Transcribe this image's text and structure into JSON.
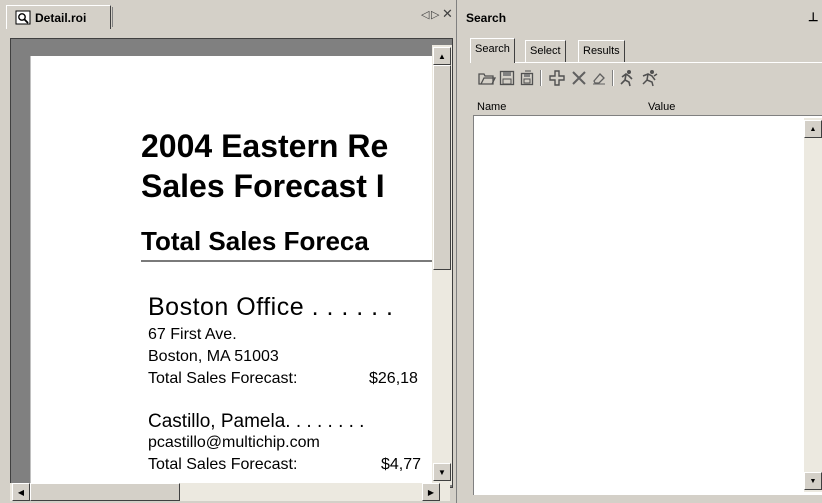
{
  "document_pane": {
    "tab_label": "Detail.roi",
    "controls": {
      "prev": "◁",
      "next": "▷",
      "close": "✕"
    },
    "report": {
      "title_line1": "2004 Eastern Re",
      "title_line2": "Sales Forecast I",
      "section_heading": "Total Sales Foreca",
      "office_name": "Boston  Office . . . . . .",
      "address_line1": "67 First Ave.",
      "address_line2": "Boston, MA  51003",
      "office_forecast_label": "Total Sales Forecast:",
      "office_forecast_value": "$26,18",
      "rep_name": "Castillo, Pamela. . . . . . . .",
      "rep_email": "pcastillo@multichip.com",
      "rep_forecast_label": "Total Sales Forecast:",
      "rep_forecast_value": "$4,77"
    }
  },
  "search_pane": {
    "title": "Search",
    "pin": "ᵩ",
    "tabs": [
      {
        "label": "Search",
        "active": true
      },
      {
        "label": "Select",
        "active": false
      },
      {
        "label": "Results",
        "active": false
      }
    ],
    "toolbar_icons": [
      "open-icon",
      "save-icon",
      "save-as-icon",
      "add-icon",
      "delete-icon",
      "clear-icon",
      "run-icon",
      "run-all-icon"
    ],
    "columns": {
      "name": "Name",
      "value": "Value"
    }
  }
}
